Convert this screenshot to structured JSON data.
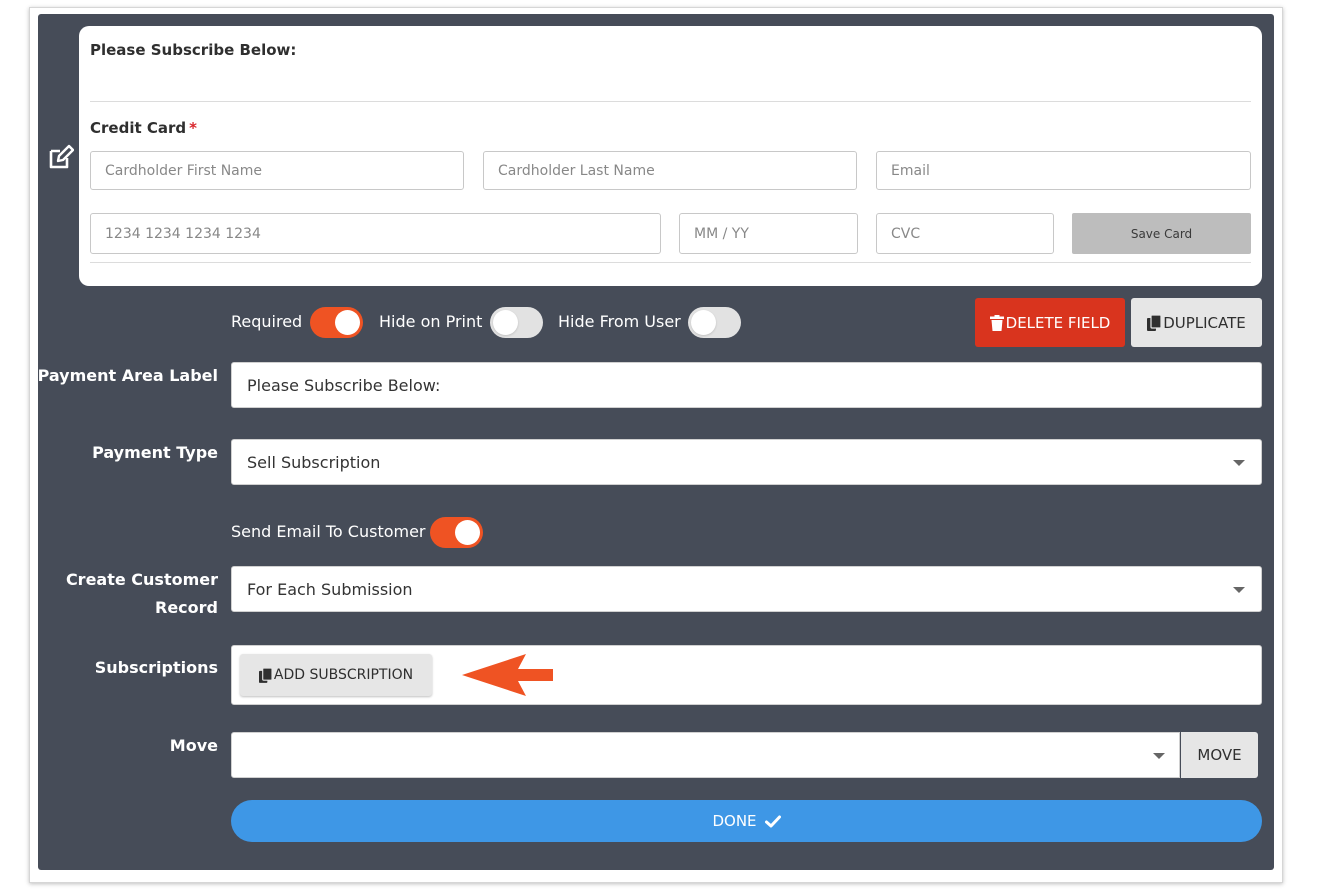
{
  "preview": {
    "title": "Please Subscribe Below:",
    "credit_card_label": "Credit Card",
    "required_mark": "*",
    "placeholders": {
      "first_name": "Cardholder First Name",
      "last_name": "Cardholder Last Name",
      "email": "Email",
      "card_number": "1234 1234 1234 1234",
      "expiry": "MM / YY",
      "cvc": "CVC"
    },
    "save_card": "Save Card"
  },
  "toggles": {
    "required": {
      "label": "Required",
      "on": true
    },
    "hide_on_print": {
      "label": "Hide on Print",
      "on": false
    },
    "hide_from_user": {
      "label": "Hide From User",
      "on": false
    },
    "send_email": {
      "label": "Send Email To Customer",
      "on": true
    }
  },
  "actions": {
    "delete_field": "DELETE FIELD",
    "duplicate": "DUPLICATE",
    "add_subscription": "ADD SUBSCRIPTION",
    "move": "MOVE",
    "done": "DONE"
  },
  "form": {
    "payment_area_label": {
      "label": "Payment Area Label",
      "value": "Please Subscribe Below:"
    },
    "payment_type": {
      "label": "Payment Type",
      "value": "Sell Subscription"
    },
    "create_customer_record": {
      "label_line1": "Create Customer",
      "label_line2": "Record",
      "value": "For Each Submission"
    },
    "subscriptions": {
      "label": "Subscriptions"
    },
    "move": {
      "label": "Move",
      "value": ""
    }
  },
  "colors": {
    "panel": "#464c58",
    "accent_orange": "#ef5323",
    "delete_red": "#d9341e",
    "done_blue": "#3e97e6",
    "required_red": "#d9262c"
  },
  "icons": [
    "edit-icon",
    "trash-icon",
    "copy-icon",
    "check-icon",
    "caret-down-icon",
    "arrow-left-icon"
  ]
}
